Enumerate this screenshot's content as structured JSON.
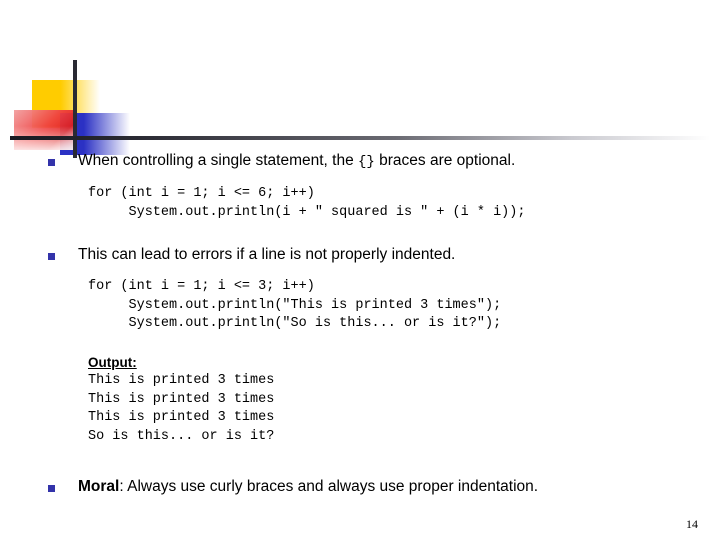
{
  "slide": {
    "page_number": "14",
    "accent_colors": {
      "bullet_square": "#3333AA",
      "logo_yellow": "#FFCC00",
      "logo_blue": "#2B31C4",
      "logo_red": "#E02020",
      "rule_dark": "#2A2A33"
    }
  },
  "bullets": [
    {
      "text_before": "When controlling a single statement, the ",
      "mono": "{}",
      "text_after": " braces are optional."
    },
    {
      "text": "This can lead to errors if a line is not properly indented."
    },
    {
      "bold": "Moral",
      "text_after": ": Always use curly braces and always use proper indentation."
    }
  ],
  "code_blocks": [
    {
      "lines": "for (int i = 1; i <= 6; i++)\n     System.out.println(i + \" squared is \" + (i * i));"
    },
    {
      "lines": "for (int i = 1; i <= 3; i++)\n     System.out.println(\"This is printed 3 times\");\n     System.out.println(\"So is this... or is it?\");"
    }
  ],
  "output": {
    "label": "Output:",
    "lines": "This is printed 3 times\nThis is printed 3 times\nThis is printed 3 times\nSo is this... or is it?"
  }
}
